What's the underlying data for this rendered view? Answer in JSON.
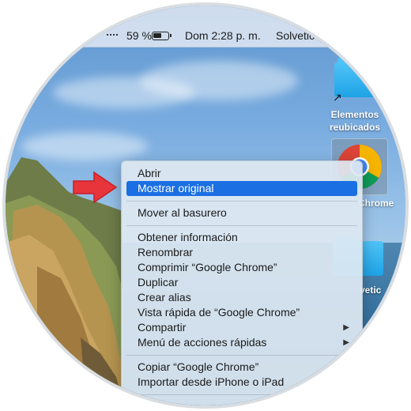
{
  "menubar": {
    "battery_percent": "59 %",
    "battery_level": 0.59,
    "clock": "Dom 2:28 p. m.",
    "user": "Solvetic"
  },
  "desktop": {
    "icons": [
      {
        "label_line1": "Elementos",
        "label_line2": "reubicados",
        "icon": "folder-icon"
      },
      {
        "label": "Chrome",
        "icon": "google-chrome-icon"
      },
      {
        "label": "vetic",
        "icon": "folder-icon"
      }
    ]
  },
  "context_menu": {
    "items": [
      {
        "label": "Abrir"
      },
      {
        "label": "Mostrar original",
        "selected": true
      },
      {
        "label": "Mover al basurero"
      },
      {
        "label": "Obtener información"
      },
      {
        "label": "Renombrar"
      },
      {
        "label": "Comprimir “Google Chrome”"
      },
      {
        "label": "Duplicar"
      },
      {
        "label": "Crear alias"
      },
      {
        "label": "Vista rápida de “Google Chrome”"
      },
      {
        "label": "Compartir",
        "submenu": true
      },
      {
        "label": "Menú de acciones rápidas",
        "submenu": true
      },
      {
        "label": "Copiar “Google Chrome”"
      },
      {
        "label": "Importar desde iPhone o iPad"
      }
    ],
    "submenu_arrow": "▶",
    "selected_color": "#1a6fe3"
  },
  "annotation": {
    "arrow_color": "#e8343b",
    "icon": "red-pointer-arrow"
  }
}
